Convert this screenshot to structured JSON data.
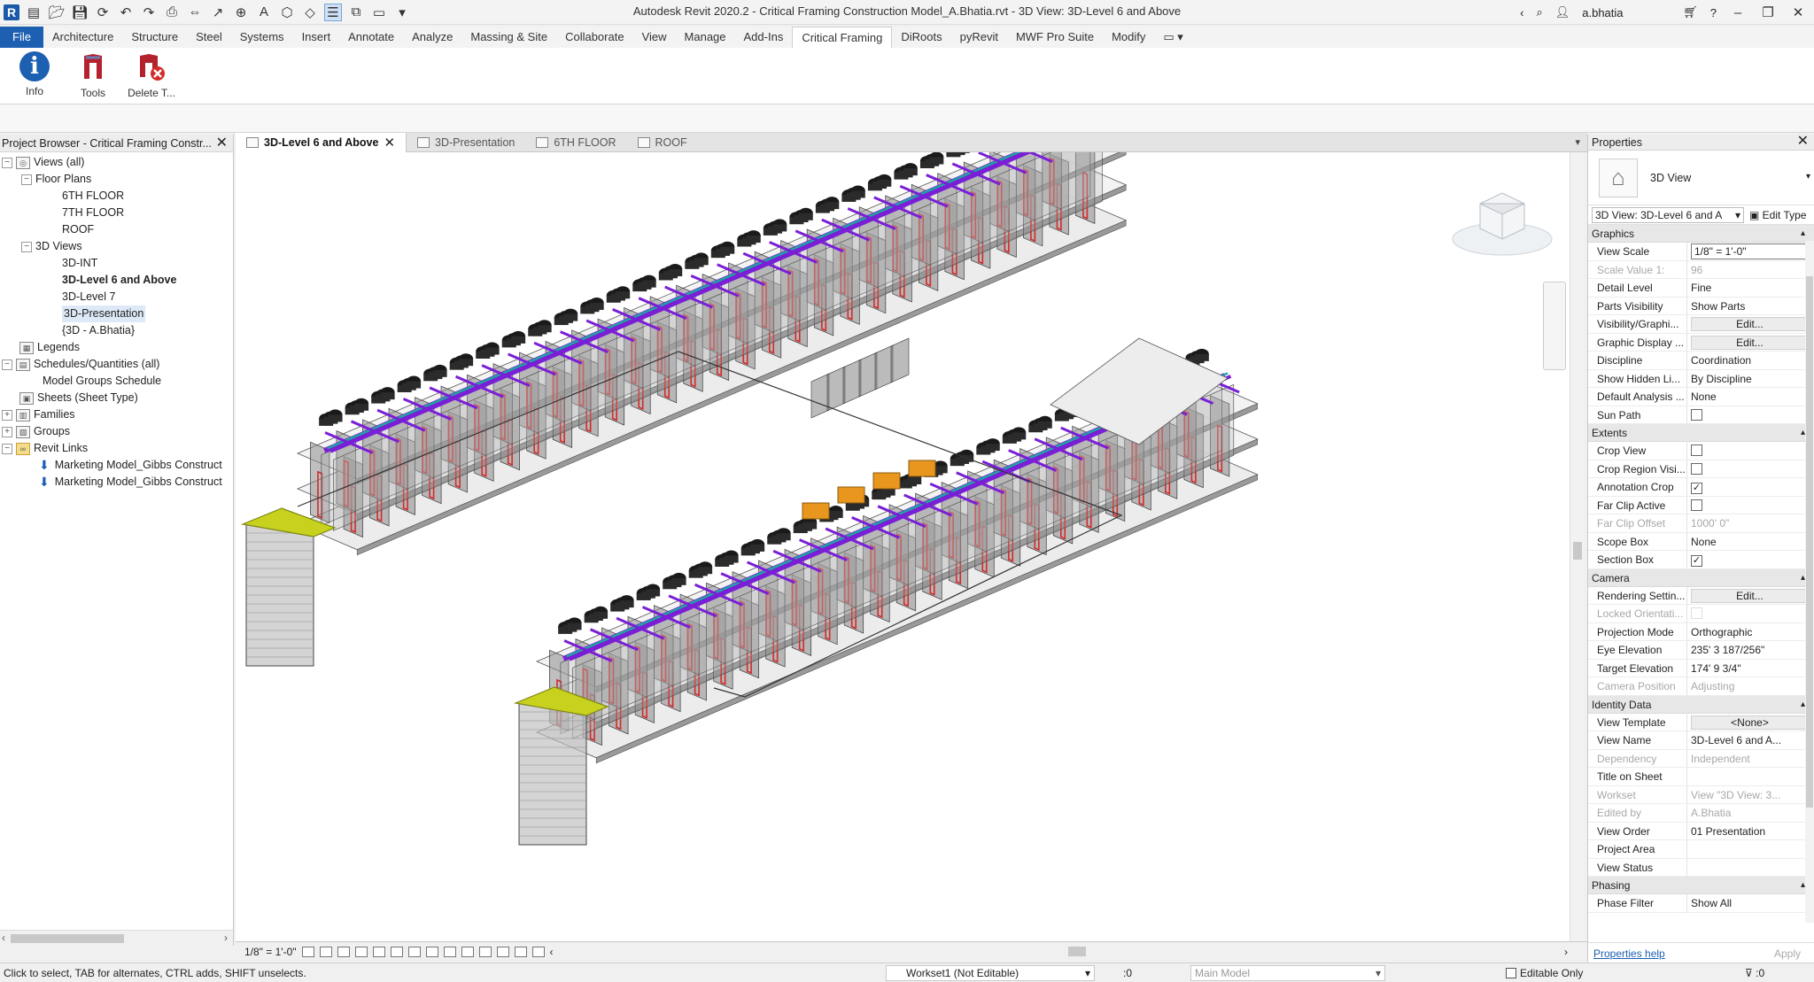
{
  "window": {
    "title": "Autodesk Revit 2020.2 - Critical Framing Construction Model_A.Bhatia.rvt - 3D View: 3D-Level 6 and Above",
    "user": "a.bhatia",
    "app_icon": "R"
  },
  "ribbon": {
    "tabs": [
      "File",
      "Architecture",
      "Structure",
      "Steel",
      "Systems",
      "Insert",
      "Annotate",
      "Analyze",
      "Massing & Site",
      "Collaborate",
      "View",
      "Manage",
      "Add-Ins",
      "Critical Framing",
      "DiRoots",
      "pyRevit",
      "MWF Pro Suite",
      "Modify"
    ],
    "active_tab": "Critical Framing",
    "buttons": {
      "info": "Info",
      "tools": "Tools",
      "delete": "Delete T..."
    }
  },
  "project_browser": {
    "title": "Project Browser - Critical Framing Constr...",
    "tree": {
      "views_all": "Views (all)",
      "floor_plans": "Floor Plans",
      "fp_6th": "6TH FLOOR",
      "fp_7th": "7TH FLOOR",
      "fp_roof": "ROOF",
      "views_3d": "3D Views",
      "v_int": "3D-INT",
      "v_level6": "3D-Level 6 and Above",
      "v_level7": "3D-Level 7",
      "v_presentation": "3D-Presentation",
      "v_abhatia": "{3D - A.Bhatia}",
      "legends": "Legends",
      "schedules": "Schedules/Quantities (all)",
      "model_groups_schedule": "Model Groups Schedule",
      "sheets": "Sheets (Sheet Type)",
      "families": "Families",
      "groups": "Groups",
      "revit_links": "Revit Links",
      "link_1": "Marketing Model_Gibbs Construct",
      "link_2": "Marketing Model_Gibbs Construct"
    }
  },
  "view_tabs": [
    {
      "label": "3D-Level 6 and Above",
      "active": true
    },
    {
      "label": "3D-Presentation",
      "active": false
    },
    {
      "label": "6TH FLOOR",
      "active": false
    },
    {
      "label": "ROOF",
      "active": false
    }
  ],
  "view_control_bar": {
    "scale": "1/8\" = 1'-0\""
  },
  "properties": {
    "title": "Properties",
    "type_name": "3D View",
    "instance_selector": "3D View: 3D-Level 6 and A",
    "edit_type": "Edit Type",
    "groups": {
      "graphics": "Graphics",
      "extents": "Extents",
      "camera": "Camera",
      "identity": "Identity Data",
      "phasing": "Phasing"
    },
    "rows": {
      "view_scale": {
        "name": "View Scale",
        "value": "1/8\" = 1'-0\""
      },
      "scale_value": {
        "name": "Scale Value    1:",
        "value": "96"
      },
      "detail_level": {
        "name": "Detail Level",
        "value": "Fine"
      },
      "parts_visibility": {
        "name": "Parts Visibility",
        "value": "Show Parts"
      },
      "visibility_graphics": {
        "name": "Visibility/Graphi...",
        "value": "Edit..."
      },
      "graphic_display": {
        "name": "Graphic Display ...",
        "value": "Edit..."
      },
      "discipline": {
        "name": "Discipline",
        "value": "Coordination"
      },
      "show_hidden": {
        "name": "Show Hidden Li...",
        "value": "By Discipline"
      },
      "default_analysis": {
        "name": "Default Analysis ...",
        "value": "None"
      },
      "sun_path": {
        "name": "Sun Path"
      },
      "crop_view": {
        "name": "Crop View"
      },
      "crop_region": {
        "name": "Crop Region Visi..."
      },
      "annotation_crop": {
        "name": "Annotation Crop"
      },
      "far_clip_active": {
        "name": "Far Clip Active"
      },
      "far_clip_offset": {
        "name": "Far Clip Offset",
        "value": "1000' 0\""
      },
      "scope_box": {
        "name": "Scope Box",
        "value": "None"
      },
      "section_box": {
        "name": "Section Box"
      },
      "rendering": {
        "name": "Rendering Settin...",
        "value": "Edit..."
      },
      "locked_orientation": {
        "name": "Locked Orientati..."
      },
      "projection_mode": {
        "name": "Projection Mode",
        "value": "Orthographic"
      },
      "eye_elevation": {
        "name": "Eye Elevation",
        "value": "235' 3 187/256\""
      },
      "target_elevation": {
        "name": "Target Elevation",
        "value": "174' 9 3/4\""
      },
      "camera_position": {
        "name": "Camera Position",
        "value": "Adjusting"
      },
      "view_template": {
        "name": "View Template",
        "value": "<None>"
      },
      "view_name": {
        "name": "View Name",
        "value": "3D-Level 6 and A..."
      },
      "dependency": {
        "name": "Dependency",
        "value": "Independent"
      },
      "title_on_sheet": {
        "name": "Title on Sheet",
        "value": ""
      },
      "workset": {
        "name": "Workset",
        "value": "View \"3D View: 3..."
      },
      "edited_by": {
        "name": "Edited by",
        "value": "A.Bhatia"
      },
      "view_order": {
        "name": "View Order",
        "value": "01 Presentation"
      },
      "project_area": {
        "name": "Project Area",
        "value": ""
      },
      "view_status": {
        "name": "View Status",
        "value": ""
      },
      "phase_filter": {
        "name": "Phase Filter",
        "value": "Show All"
      }
    },
    "help_link": "Properties help",
    "apply": "Apply"
  },
  "status_bar": {
    "hint": "Click to select, TAB for alternates, CTRL adds, SHIFT unselects.",
    "workset": "Workset1 (Not Editable)",
    "count": ":0",
    "model": "Main Model",
    "editable_only": "Editable Only",
    "filter_count": ":0"
  },
  "colors": {
    "file_tab": "#1d5fb1",
    "ductwork": "#7a1fd6",
    "framing": "#d42a2a",
    "piping": "#1fa3a3",
    "equipment": "#e8961e",
    "stair_top": "#c8d21e"
  }
}
